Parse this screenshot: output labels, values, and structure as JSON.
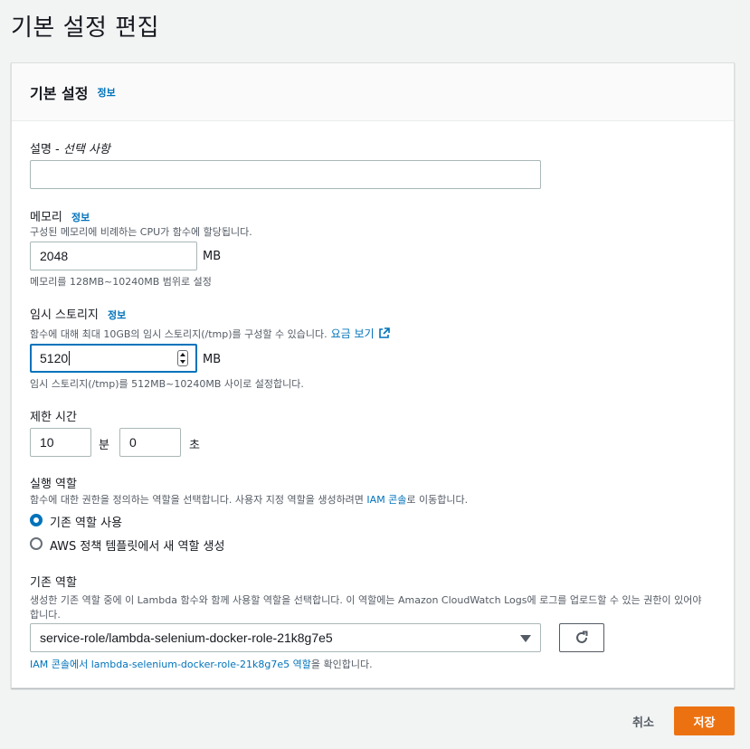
{
  "page": {
    "title": "기본 설정 편집"
  },
  "card": {
    "title": "기본 설정",
    "info": "정보"
  },
  "description": {
    "label": "설명 - ",
    "label_optional": "선택 사항",
    "value": ""
  },
  "memory": {
    "label": "메모리",
    "info": "정보",
    "desc": "구성된 메모리에 비례하는 CPU가 함수에 할당됩니다.",
    "value": "2048",
    "unit": "MB",
    "hint": "메모리를 128MB~10240MB 범위로 설정"
  },
  "ephemeral": {
    "label": "임시 스토리지",
    "info": "정보",
    "desc": "함수에 대해 최대 10GB의 임시 스토리지(/tmp)를 구성할 수 있습니다.",
    "pricing_link": "요금 보기",
    "value": "5120",
    "unit": "MB",
    "hint": "임시 스토리지(/tmp)를 512MB~10240MB 사이로 설정합니다."
  },
  "timeout": {
    "label": "제한 시간",
    "minutes": "10",
    "minutes_unit": "분",
    "seconds": "0",
    "seconds_unit": "초"
  },
  "exec_role": {
    "label": "실행 역할",
    "desc_prefix": "함수에 대한 권한을 정의하는 역할을 선택합니다. 사용자 지정 역할을 생성하려면 ",
    "desc_link": "IAM 콘솔",
    "desc_suffix": "로 이동합니다.",
    "options": [
      {
        "label": "기존 역할 사용",
        "checked": true
      },
      {
        "label": "AWS 정책 템플릿에서 새 역할 생성",
        "checked": false
      }
    ]
  },
  "existing_role": {
    "label": "기존 역할",
    "desc_line1": "생성한 기존 역할 중에 이 Lambda 함수와 함께 사용할 역할을 선택합니다. 이 역할에는 Amazon CloudWatch Logs에 로그를 업로드할 수 있는 권한이 있어야",
    "desc_line2": "합니다.",
    "selected": "service-role/lambda-selenium-docker-role-21k8g7e5",
    "view_link": "IAM 콘솔에서 lambda-selenium-docker-role-21k8g7e5 역할",
    "view_suffix": "을 확인합니다."
  },
  "footer": {
    "cancel": "취소",
    "save": "저장"
  },
  "colors": {
    "accent": "#0073bb",
    "primary_button": "#ec7211"
  },
  "icons": {
    "external_link": "external-link-icon",
    "refresh": "refresh-icon",
    "dropdown": "caret-down-icon"
  }
}
